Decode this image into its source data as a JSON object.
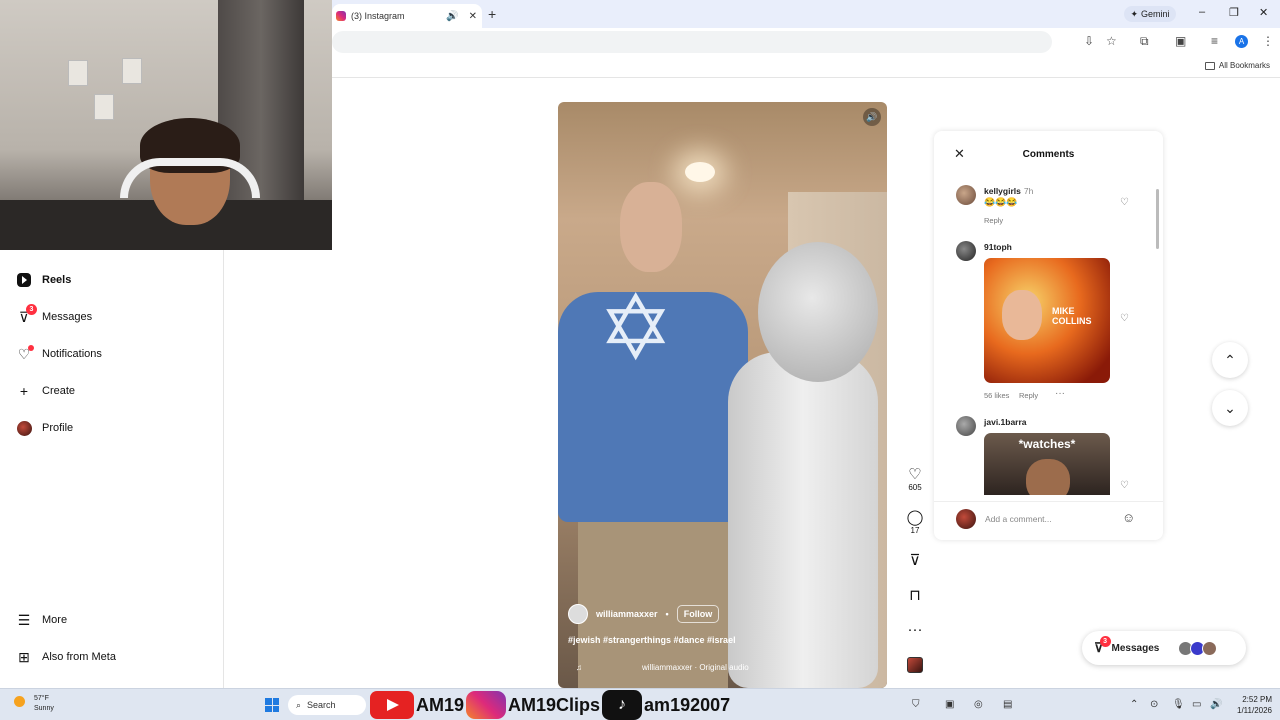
{
  "browser": {
    "tab_title": "(3) Instagram",
    "gemini_label": "Gemini",
    "all_bookmarks": "All Bookmarks",
    "window_controls": [
      "–",
      "❐",
      "✕"
    ]
  },
  "sidebar": {
    "items": [
      {
        "label": "Reels",
        "icon": "reels-icon"
      },
      {
        "label": "Messages",
        "icon": "messages-icon",
        "badge": "3"
      },
      {
        "label": "Notifications",
        "icon": "heart-icon"
      },
      {
        "label": "Create",
        "icon": "plus-icon"
      },
      {
        "label": "Profile",
        "icon": "profile-avatar"
      }
    ],
    "bottom_items": [
      {
        "label": "More",
        "icon": "menu-icon"
      },
      {
        "label": "Also from Meta",
        "icon": "meta-apps-icon"
      }
    ]
  },
  "reel": {
    "author": "williammaxxer",
    "separator": "•",
    "follow_label": "Follow",
    "caption": "#jewish #strangerthings #dance #israel",
    "audio": "williammaxxer · Original audio",
    "likes": "605",
    "comments_count": "17"
  },
  "comments": {
    "title": "Comments",
    "items": [
      {
        "user": "kellygirls",
        "time": "7h",
        "text": "😂😂😂",
        "reply": "Reply"
      },
      {
        "user": "91toph",
        "image_text": "MIKE COLLINS",
        "likes": "56 likes",
        "reply": "Reply",
        "more": "···"
      },
      {
        "user": "javi.1barra",
        "image_text": "*watches*"
      }
    ],
    "add_placeholder": "Add a comment..."
  },
  "messages_pill": {
    "label": "Messages",
    "badge": "3"
  },
  "taskbar": {
    "temperature": "57°F",
    "condition": "Sunny",
    "search_label": "Search",
    "overlay_text": [
      "AM19",
      "AM19Clips",
      "am192007"
    ],
    "time": "2:52 PM",
    "date": "1/11/2026"
  },
  "colors": {
    "accent": "#ff3040",
    "link": "#00376b",
    "shirt": "#4f78b6"
  }
}
